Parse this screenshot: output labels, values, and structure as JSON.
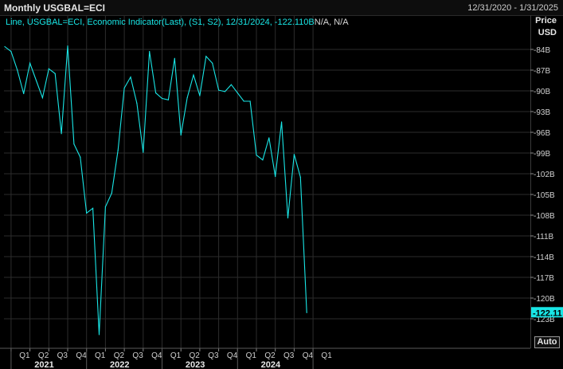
{
  "header": {
    "title": "Monthly USGBAL=ECI",
    "date_range": "12/31/2020 - 1/31/2025"
  },
  "legend": {
    "text": "Line, USGBAL=ECI, Economic Indicator(Last), (S1, S2), 12/31/2024, -122.110B",
    "suffix": "N/A, N/A"
  },
  "y_axis": {
    "title_line1": "Price",
    "title_line2": "USD"
  },
  "auto_button": "Auto",
  "last_value_label": "-122.11",
  "colors": {
    "line": "#19e6e6",
    "grid": "#2c2c2c",
    "background": "#000000"
  },
  "chart_data": {
    "type": "line",
    "x": [
      "2020-12",
      "2021-01",
      "2021-02",
      "2021-03",
      "2021-04",
      "2021-05",
      "2021-06",
      "2021-07",
      "2021-08",
      "2021-09",
      "2021-10",
      "2021-11",
      "2021-12",
      "2022-01",
      "2022-02",
      "2022-03",
      "2022-04",
      "2022-05",
      "2022-06",
      "2022-07",
      "2022-08",
      "2022-09",
      "2022-10",
      "2022-11",
      "2022-12",
      "2023-01",
      "2023-02",
      "2023-03",
      "2023-04",
      "2023-05",
      "2023-06",
      "2023-07",
      "2023-08",
      "2023-09",
      "2023-10",
      "2023-11",
      "2023-12",
      "2024-01",
      "2024-02",
      "2024-03",
      "2024-04",
      "2024-05",
      "2024-06",
      "2024-07",
      "2024-08",
      "2024-09",
      "2024-10",
      "2024-11",
      "2024-12"
    ],
    "series": [
      {
        "values": [
          -83.6,
          -84.3,
          -87.0,
          -90.4,
          -86.0,
          -88.5,
          -91.0,
          -86.8,
          -87.5,
          -96.2,
          -83.5,
          -97.7,
          -99.6,
          -107.7,
          -107.0,
          -125.3,
          -106.8,
          -104.8,
          -98.6,
          -89.6,
          -88.0,
          -91.8,
          -98.9,
          -84.3,
          -90.3,
          -91.1,
          -91.3,
          -85.3,
          -96.4,
          -91.0,
          -87.7,
          -90.7,
          -85.0,
          -86.0,
          -89.9,
          -90.1,
          -89.1,
          -90.3,
          -91.5,
          -91.5,
          -99.3,
          -100.0,
          -96.8,
          -102.4,
          -94.5,
          -108.4,
          -99.2,
          -102.5,
          -122.11
        ]
      }
    ],
    "y_ticks": [
      "-84B",
      "-87B",
      "-90B",
      "-93B",
      "-96B",
      "-99B",
      "-102B",
      "-105B",
      "-108B",
      "-111B",
      "-114B",
      "-117B",
      "-120B",
      "-123B"
    ],
    "y_tick_values": [
      -84,
      -87,
      -90,
      -93,
      -96,
      -99,
      -102,
      -105,
      -108,
      -111,
      -114,
      -117,
      -120,
      -123
    ],
    "ylim": [
      -126.8,
      -80.6
    ],
    "quarter_ticks": [
      "Q1",
      "Q2",
      "Q3",
      "Q4",
      "Q1",
      "Q2",
      "Q3",
      "Q4",
      "Q1",
      "Q2",
      "Q3",
      "Q4",
      "Q1",
      "Q2",
      "Q3",
      "Q4",
      "Q1"
    ],
    "quarter_months": [
      "2021-01",
      "2021-04",
      "2021-07",
      "2021-10",
      "2022-01",
      "2022-04",
      "2022-07",
      "2022-10",
      "2023-01",
      "2023-04",
      "2023-07",
      "2023-10",
      "2024-01",
      "2024-04",
      "2024-07",
      "2024-10",
      "2025-01"
    ],
    "year_labels": [
      "2021",
      "2022",
      "2023",
      "2024"
    ],
    "year_months": [
      "2021-05",
      "2022-05",
      "2023-05",
      "2024-05"
    ],
    "grid": true
  }
}
